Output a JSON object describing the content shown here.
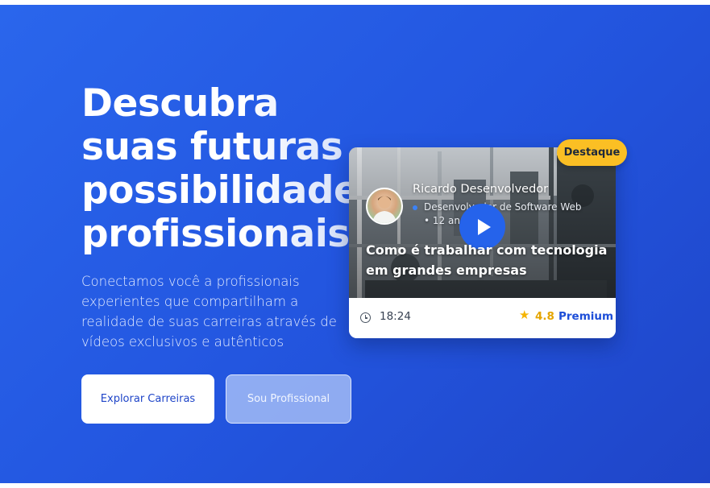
{
  "hero": {
    "headline_lines": [
      "Descubra",
      "suas futuras",
      "possibilidades",
      "profissionais"
    ],
    "subtitle": "Conectamos você a profissionais experientes que compartilham a realidade de suas carreiras através de vídeos exclusivos e autênticos",
    "primary_button": "Explorar Carreiras",
    "secondary_button": "Sou Profissional"
  },
  "featured_video": {
    "badge": "Destaque",
    "author_name": "Ricardo Desenvolvedor",
    "author_meta": "Desenvolvedor de Software Web • 12 anos exp.",
    "title": "Como é trabalhar com tecnologia em grandes empresas",
    "duration": "18:24",
    "rating": "4.8",
    "tier": "Premium"
  },
  "colors": {
    "hero_gradient_start": "#2a66ec",
    "hero_gradient_end": "#1f45c8",
    "accent_blue": "#2563eb",
    "badge_yellow": "#fbbf24",
    "rating_yellow": "#e5a500"
  },
  "icons": [
    "play-icon",
    "clock-icon",
    "star-icon"
  ]
}
